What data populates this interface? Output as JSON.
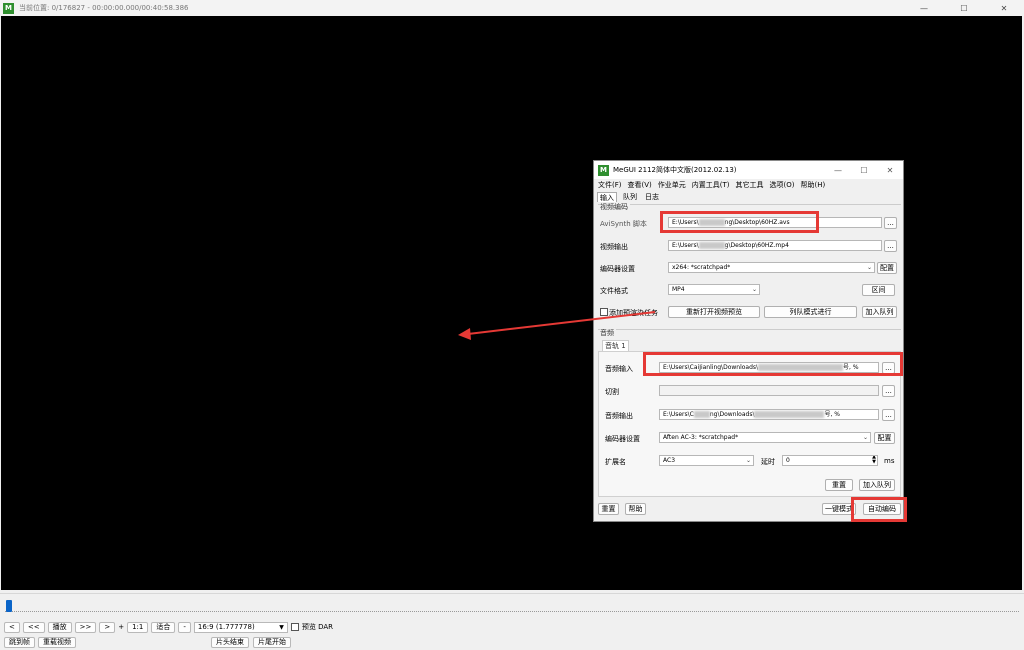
{
  "main_window": {
    "app_icon": "MeGUI-icon",
    "title": "当前位置: 0/176827   -   00:00:00.000/00:40:58.386",
    "caption": {
      "minimize": "—",
      "maximize": "☐",
      "close": "✕"
    },
    "seek_position": 0.0
  },
  "controls": {
    "prev": "<",
    "rewind": "<<",
    "play": "播放",
    "fast_forward": ">>",
    "next": ">",
    "plus": "+",
    "ratio_1_1": "1:1",
    "fit": "适合",
    "minus": "-",
    "aspect_ratio": "16:9 (1.777778)",
    "preview_dar": "预览 DAR",
    "jump_to": "跳到帧",
    "reload_video": "重载视频",
    "intro_end": "片头结束",
    "outro_start": "片尾开始"
  },
  "dialog": {
    "app_icon": "MeGUI-icon",
    "title": "MeGUI 2112简体中文版(2012.02.13)",
    "caption": {
      "minimize": "—",
      "maximize": "☐",
      "close": "✕"
    },
    "menu": [
      "文件(F)",
      "查看(V)",
      "作业单元",
      "内置工具(T)",
      "其它工具",
      "选项(O)",
      "帮助(H)"
    ],
    "tabs": [
      "输入",
      "队列",
      "日志"
    ],
    "video_section": {
      "label": "视频编码",
      "avisynth_label": "AviSynth 脚本",
      "avisynth_value_prefix": "E:\\Users\\",
      "avisynth_value_suffix": "ng\\Desktop\\60HZ.avs",
      "video_output_label": "视频输出",
      "video_output_prefix": "E:\\Users\\",
      "video_output_suffix": "g\\Desktop\\60HZ.mp4",
      "encoder_settings_label": "编码器设置",
      "encoder_settings_value": "x264: *scratchpad*",
      "config_button": "配置",
      "file_format_label": "文件格式",
      "file_format_value": "MP4",
      "region_button": "区间",
      "add_render_task": "添加预渲染任务",
      "reopen_preview": "重新打开视频预览",
      "queue_mode": "列队模式进行",
      "add_to_queue": "加入队列",
      "browse": "..."
    },
    "audio_section": {
      "label": "音频",
      "track_tab": "音轨 1",
      "audio_input_label": "音频输入",
      "audio_input_prefix": "E:\\Users\\CaiJianling\\Downloads\\",
      "audio_input_suffix": "号, %",
      "cut_label": "切割",
      "audio_output_label": "音频输出",
      "audio_output_prefix": "E:\\Users\\C",
      "audio_output_mid": "ng\\Downloads\\",
      "audio_output_suffix": "号, %",
      "encoder_settings_label": "编码器设置",
      "encoder_settings_value": "Aften AC-3: *scratchpad*",
      "config_button": "配置",
      "extension_label": "扩展名",
      "extension_value": "AC3",
      "delay_label": "延时",
      "delay_value": "0",
      "delay_unit": "ms",
      "reset_button": "重置",
      "add_to_queue": "加入队列",
      "browse": "..."
    },
    "footer": {
      "reset": "重置",
      "help": "帮助",
      "one_click": "一键模式",
      "auto_encode": "自动编码"
    }
  },
  "colors": {
    "highlight": "#e53935",
    "video_bg": "#000000",
    "seek_thumb": "#0a64c8",
    "app_icon": "#2f8f2f"
  }
}
